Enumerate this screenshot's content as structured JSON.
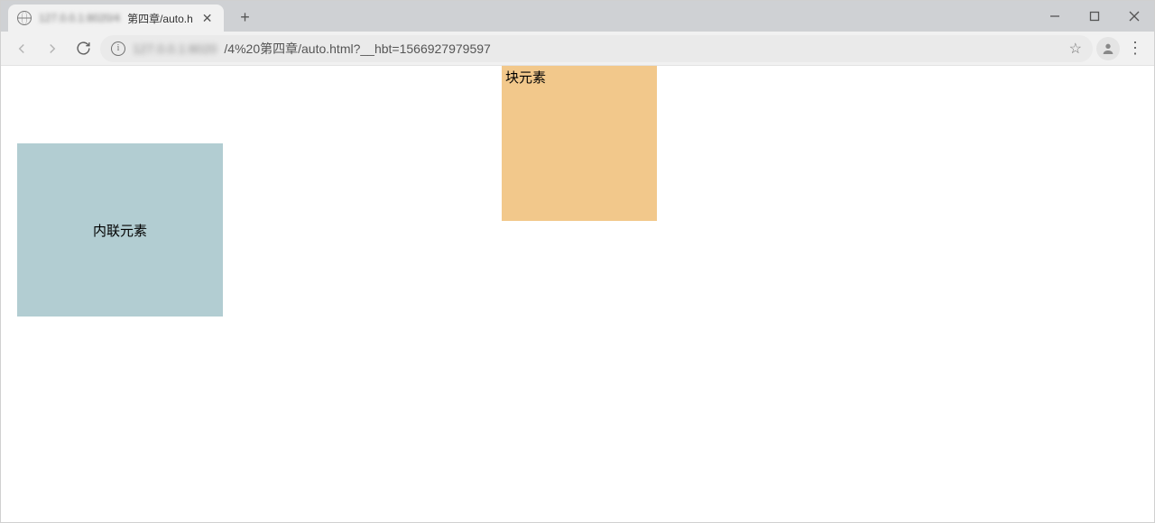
{
  "browser": {
    "tab": {
      "title_blurred": "127.0.0.1:8020/4",
      "title_clear": " 第四章/auto.h"
    },
    "address": {
      "url_blurred": "127.0.0.1:8020",
      "url_clear": "/4%20第四章/auto.html?__hbt=1566927979597"
    }
  },
  "page": {
    "block": {
      "text": "块元素",
      "bg": "#f2c88b"
    },
    "inline": {
      "text": "内联元素",
      "bg": "#b2cdd2"
    }
  }
}
